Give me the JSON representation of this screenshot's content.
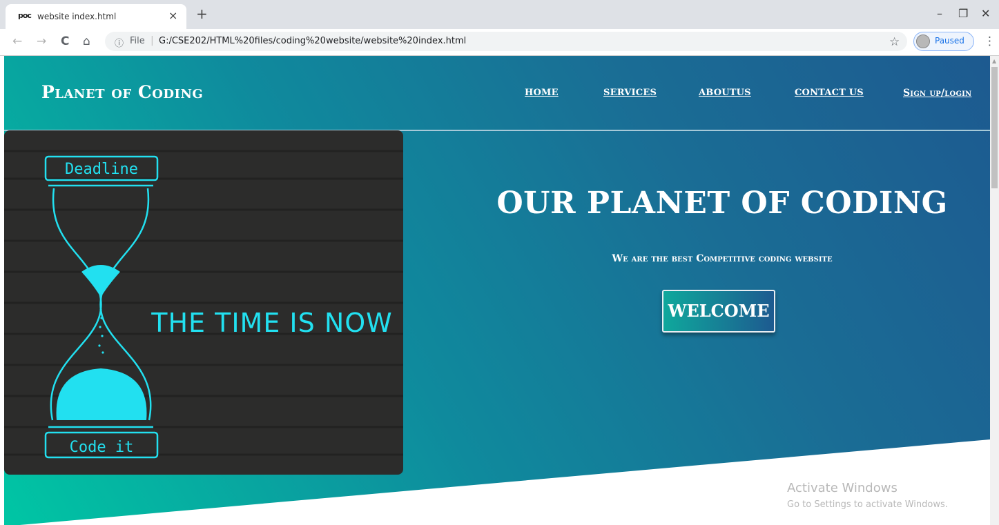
{
  "browser": {
    "tab": {
      "favicon_text": "poc",
      "title": "website index.html",
      "close": "×"
    },
    "new_tab": "+",
    "window_controls": {
      "minimize": "–",
      "restore": "❐",
      "close": "✕"
    },
    "nav": {
      "back": "←",
      "forward": "→",
      "reload": "C",
      "home": "⌂"
    },
    "omnibox": {
      "info_icon": "ⓘ",
      "scheme": "File",
      "url": "G:/CSE202/HTML%20files/coding%20website/website%20index.html"
    },
    "star": "☆",
    "profile_label": "Paused",
    "menu": "⋮"
  },
  "site": {
    "logo": "Planet of Coding",
    "nav": [
      {
        "label": "HOME"
      },
      {
        "label": "SERVICES"
      },
      {
        "label": "ABOUTUS"
      },
      {
        "label": "CONTACT US"
      },
      {
        "label": "Sign up/login"
      }
    ],
    "hero": {
      "image": {
        "top_label": "Deadline",
        "bottom_label": "Code it",
        "slogan": "THE TIME IS NOW"
      },
      "title": "OUR PLANET OF CODING",
      "subtitle": "We are the best Competitive coding website",
      "cta": "WELCOME"
    }
  },
  "os_watermark": {
    "title": "Activate Windows",
    "subtitle": "Go to Settings to activate Windows."
  },
  "colors": {
    "gradient_start": "#00c6a4",
    "gradient_end": "#1d5a90",
    "hourglass": "#22e0f0"
  }
}
